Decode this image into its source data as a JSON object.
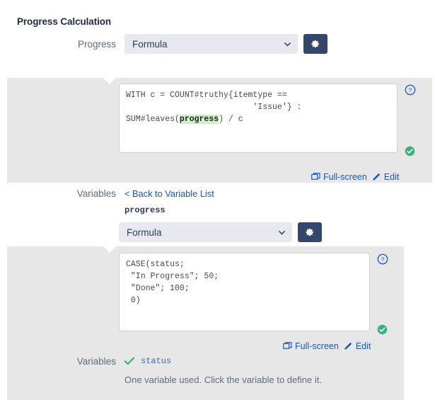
{
  "section": {
    "title": "Progress Calculation"
  },
  "progress_field": {
    "label": "Progress",
    "select_value": "Formula",
    "chevron_icon": "chevron-down-icon",
    "gear_icon": "gear-icon"
  },
  "outer_formula": {
    "code_line1": "WITH c = COUNT#truthy{itemtype ==",
    "code_line2": "                          'Issue'} :",
    "code_line3_pre": "SUM#leaves(",
    "code_line3_var": "progress",
    "code_line3_post": ") / c",
    "help_icon": "help-circle-icon",
    "valid_icon": "check-circle-icon",
    "fullscreen_label": "Full-screen",
    "fullscreen_icon": "fullscreen-icon",
    "edit_label": "Edit",
    "edit_icon": "pencil-icon"
  },
  "variables_outer": {
    "label": "Variables",
    "back_link": "< Back to Variable List",
    "variable_name": "progress",
    "select_value": "Formula",
    "chevron_icon": "chevron-down-icon",
    "gear_icon": "gear-icon"
  },
  "inner_formula": {
    "code": "CASE(status;\n \"In Progress\"; 50;\n \"Done\"; 100;\n 0)",
    "help_icon": "help-circle-icon",
    "valid_icon": "check-circle-icon",
    "fullscreen_label": "Full-screen",
    "fullscreen_icon": "fullscreen-icon",
    "edit_label": "Edit",
    "edit_icon": "pencil-icon"
  },
  "variables_inner": {
    "label": "Variables",
    "check_icon": "check-mark-icon",
    "variable_token": "status",
    "hint": "One variable used. Click the variable to define it."
  },
  "colors": {
    "panel_bg": "#e7e7e7",
    "accent_blue": "#1a56c4",
    "gear_navy": "#33466b",
    "select_bg": "#e7e9ee",
    "valid_green": "#36b37e",
    "highlight_green": "#cff0c8"
  }
}
